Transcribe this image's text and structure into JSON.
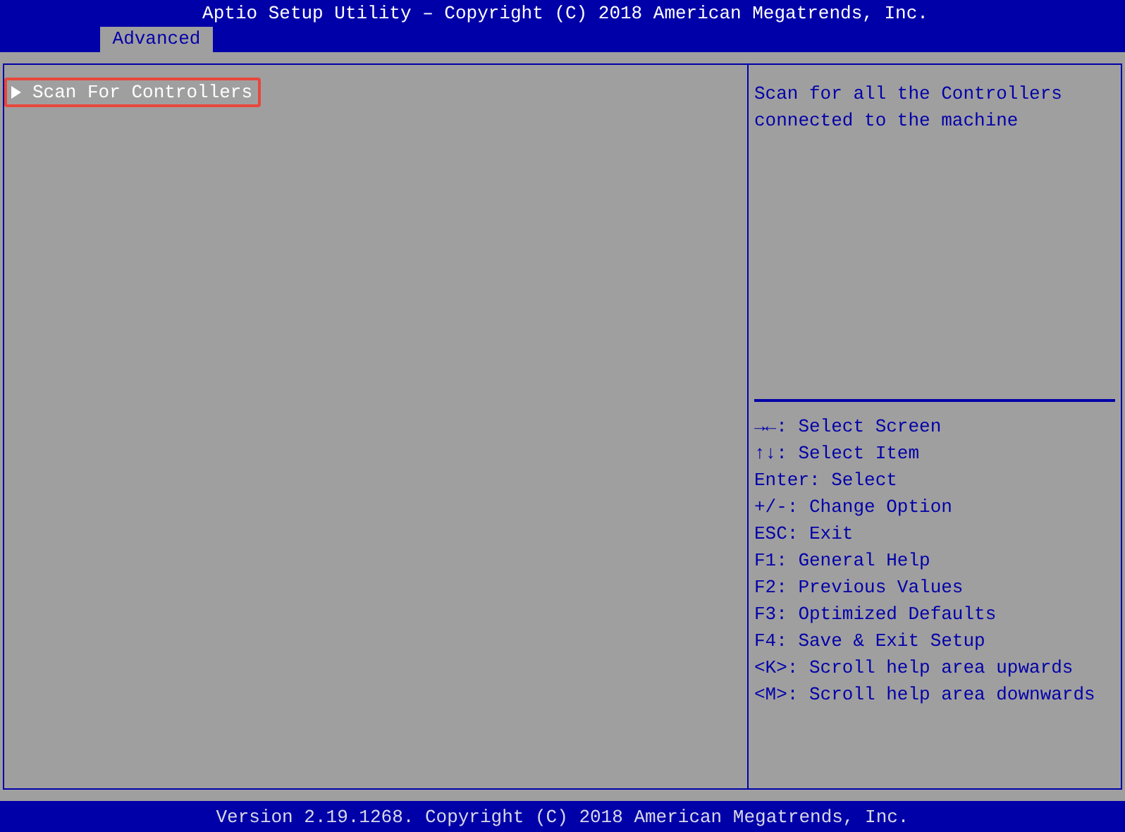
{
  "header": {
    "title": "Aptio Setup Utility – Copyright (C) 2018 American Megatrends, Inc.",
    "tabs": [
      {
        "label": "Advanced",
        "selected": true
      }
    ]
  },
  "menu": {
    "items": [
      {
        "label": "Scan For Controllers",
        "selected": true,
        "kind": "submenu"
      }
    ]
  },
  "help": {
    "description": "Scan for all the Controllers connected to the machine",
    "keys": [
      "**→←**: Select Screen",
      "**↑↓**: Select Item",
      "Enter: Select",
      "+/-: Change Option",
      "ESC: Exit",
      "F1: General Help",
      "F2: Previous Values",
      "F3: Optimized Defaults",
      "F4: Save & Exit Setup",
      "<K>: Scroll help area upwards",
      "<M>: Scroll help area downwards"
    ]
  },
  "footer": {
    "text": "Version 2.19.1268. Copyright (C) 2018 American Megatrends, Inc."
  }
}
